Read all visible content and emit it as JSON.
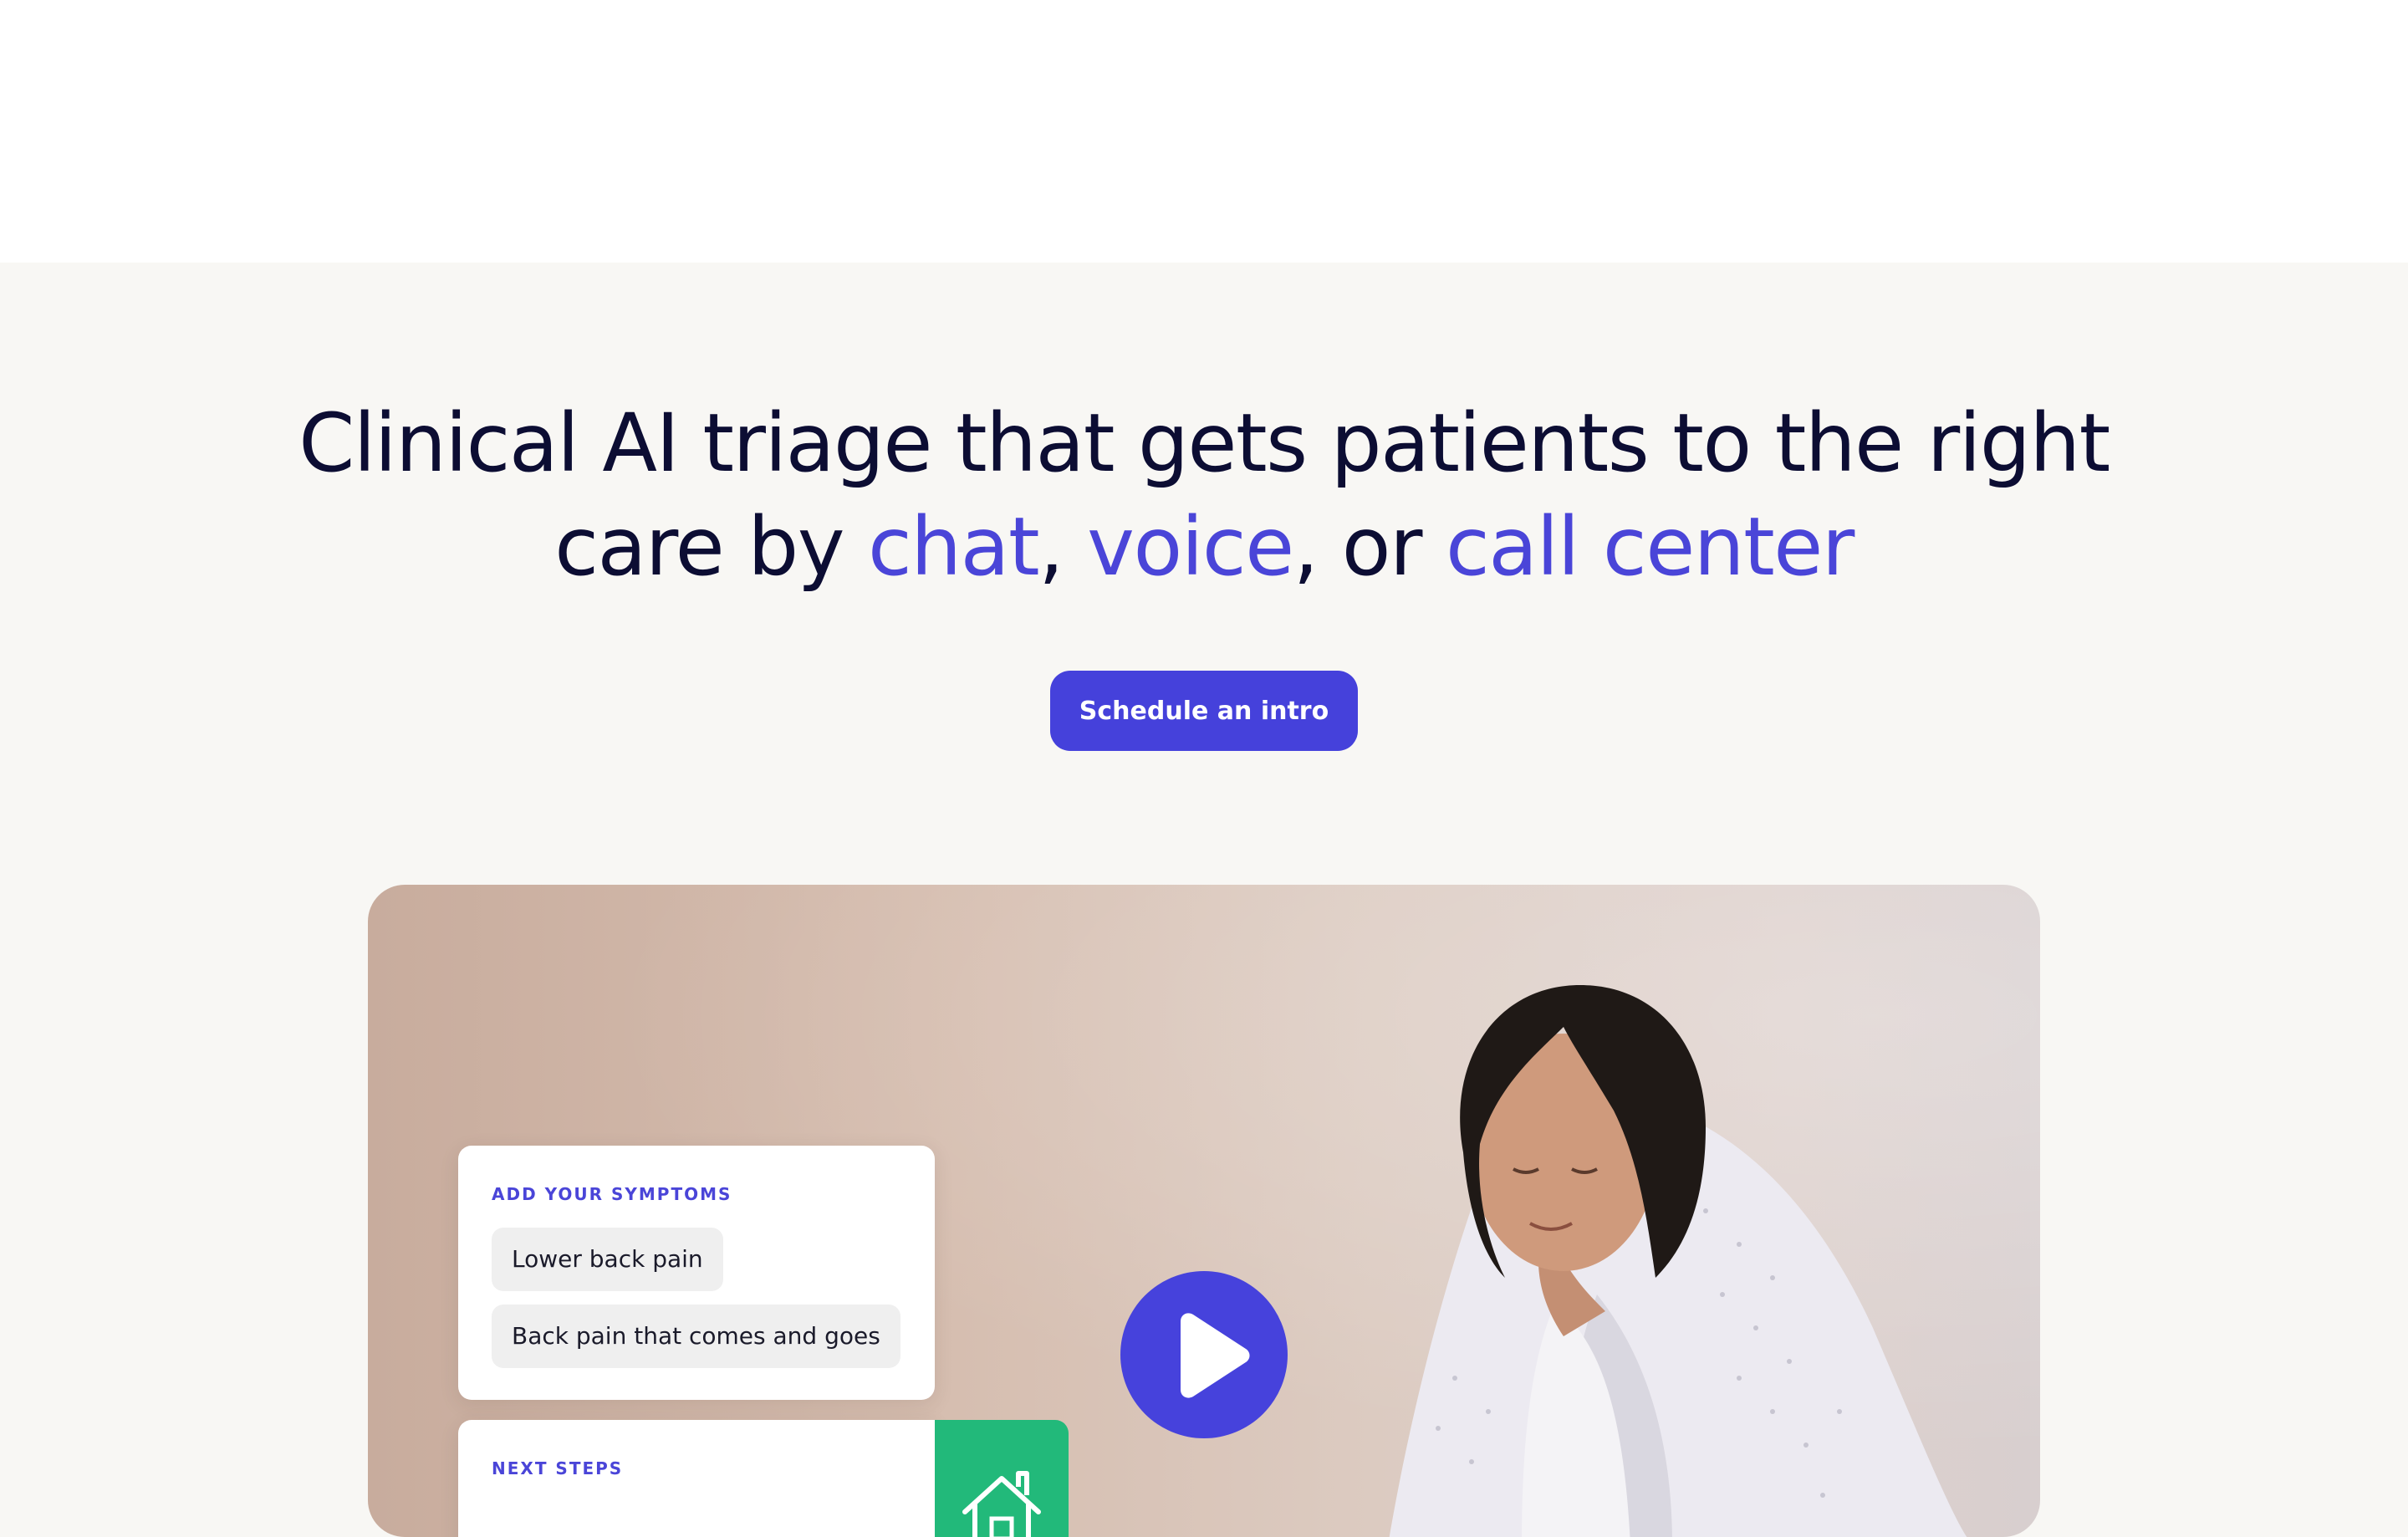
{
  "hero": {
    "headline_part1": "Clinical AI triage that gets patients to the right",
    "headline_part2": "care by ",
    "highlight_chat": "chat",
    "sep1": ", ",
    "highlight_voice": "voice",
    "sep2": ", or ",
    "highlight_call_center": "call center",
    "cta_label": "Schedule an intro"
  },
  "video": {
    "symptoms_card": {
      "label": "ADD YOUR SYMPTOMS",
      "chips": [
        "Lower back pain",
        "Back pain that comes and goes"
      ]
    },
    "next_steps_card": {
      "label": "NEXT STEPS",
      "icon": "home-icon"
    },
    "play_icon": "play-icon"
  },
  "colors": {
    "accent": "#4541db",
    "heading": "#0c0d33",
    "highlight": "#4a45d8",
    "next_steps_tile": "#22b97a",
    "page_background": "#f8f7f4"
  }
}
